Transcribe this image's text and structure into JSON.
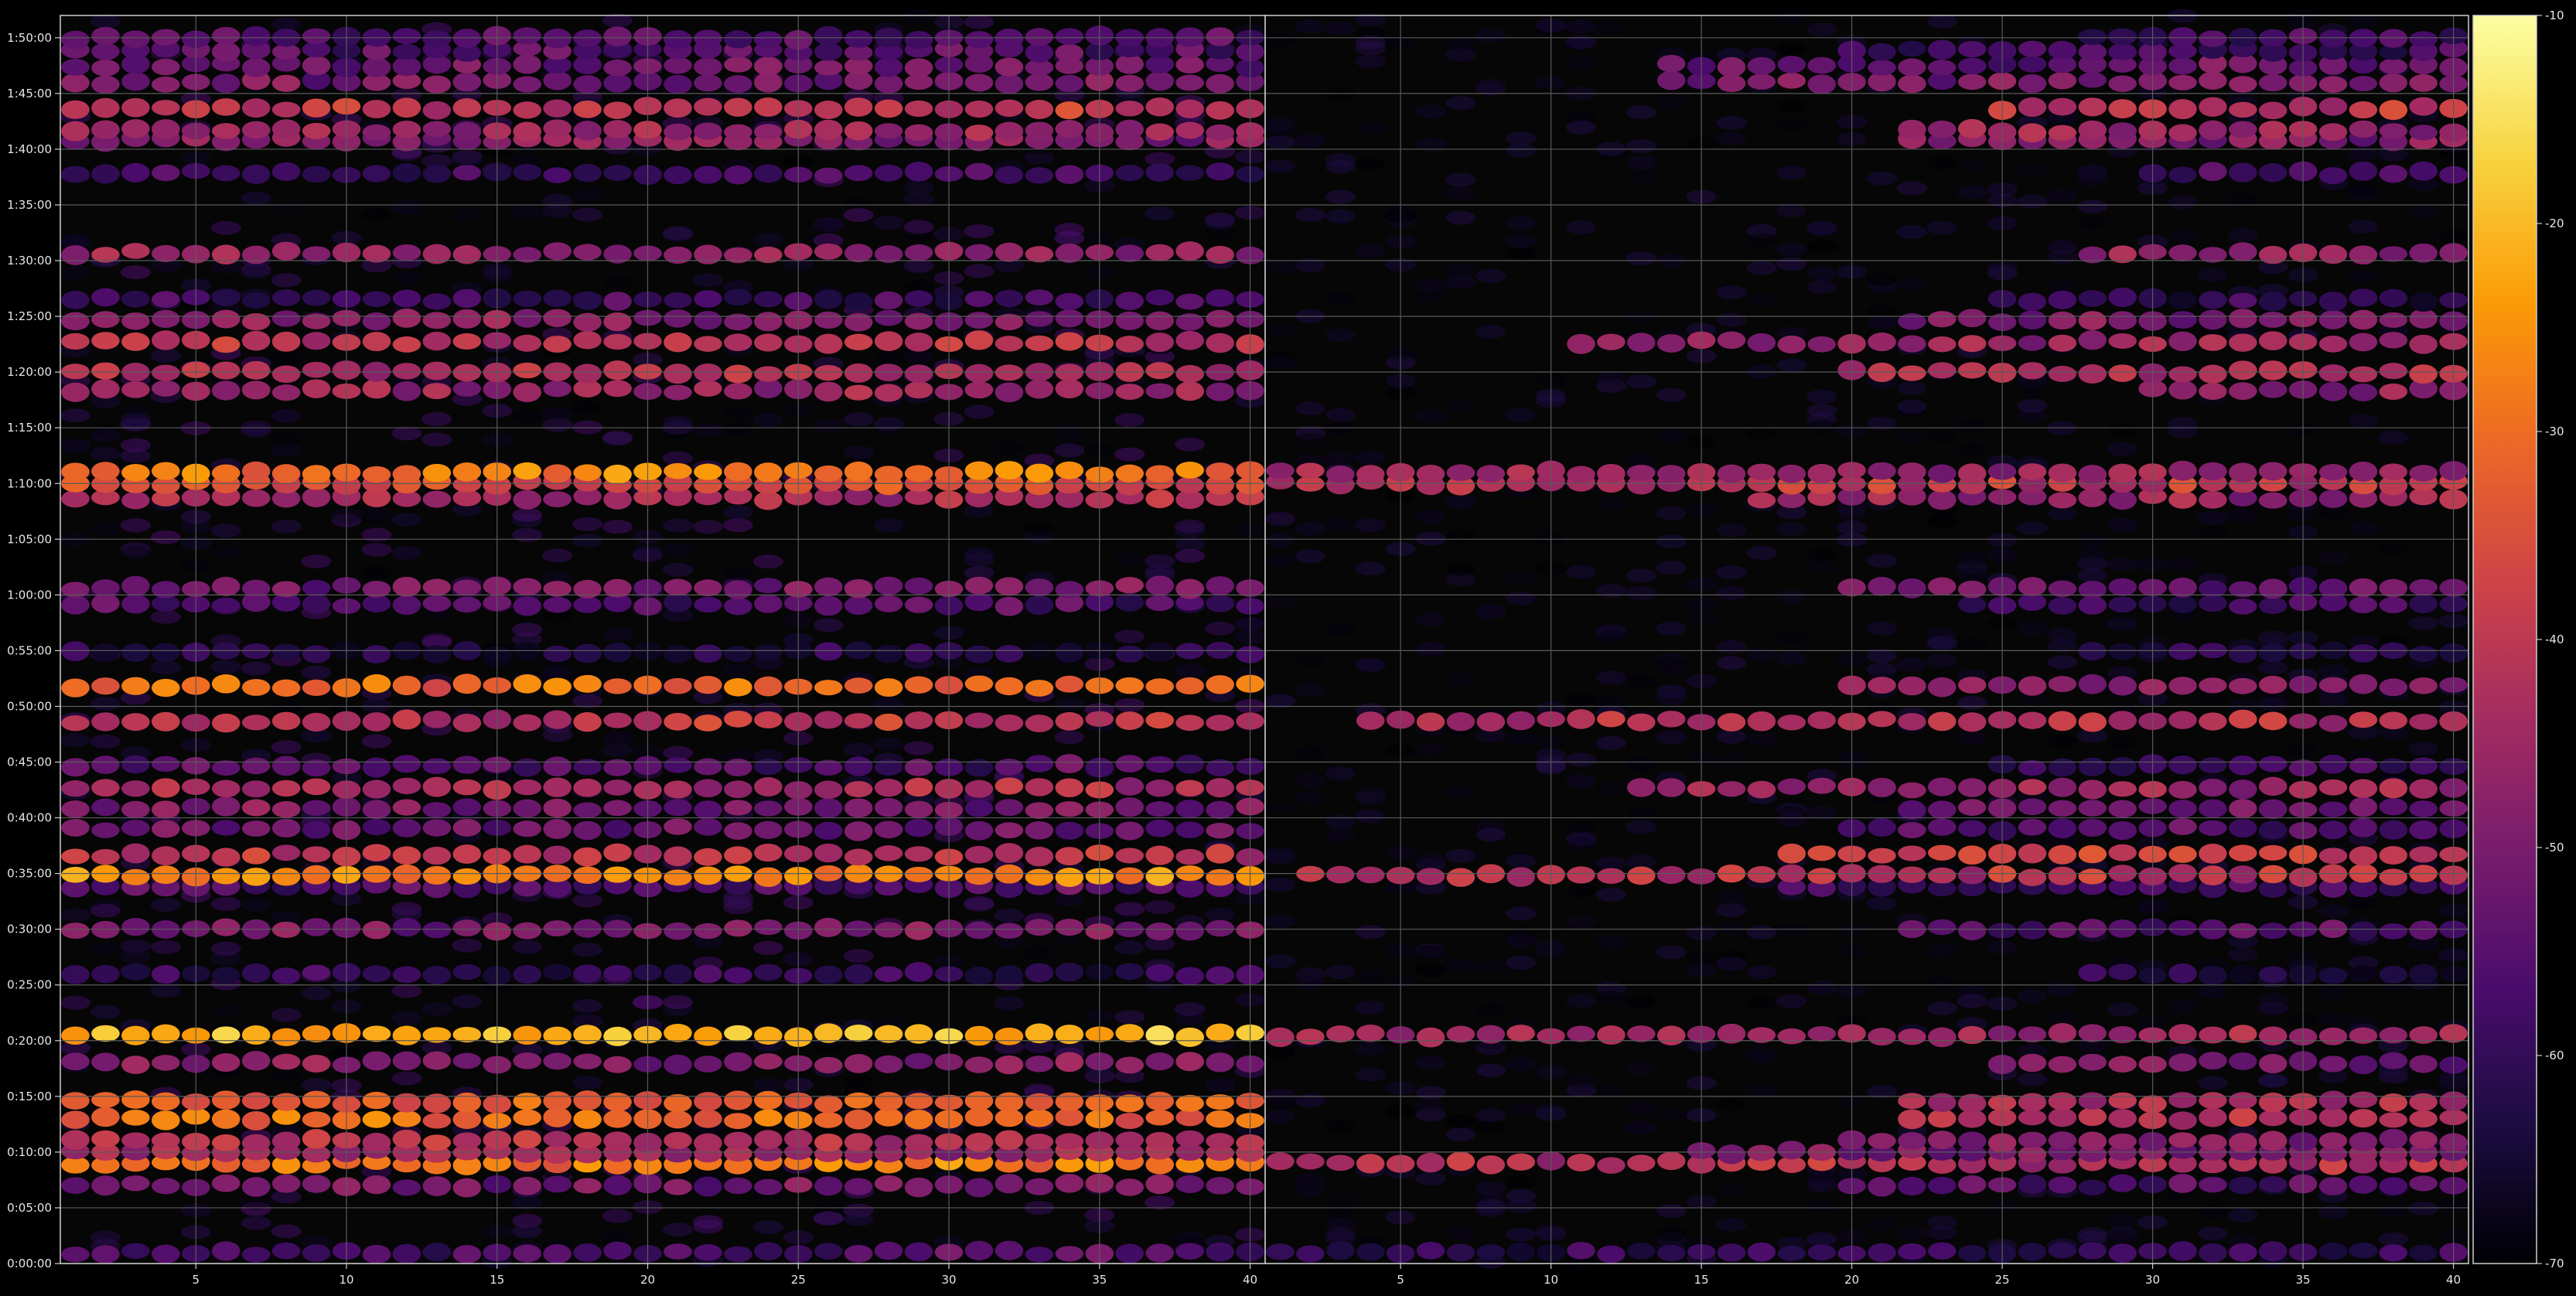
{
  "chart_data": [
    {
      "type": "heatmap",
      "panel": "left",
      "xlim": [
        1,
        40
      ],
      "x_ticks": [
        "5",
        "10",
        "15",
        "20",
        "25",
        "30",
        "35",
        "40"
      ],
      "x_tick_values": [
        5,
        10,
        15,
        20,
        25,
        30,
        35,
        40
      ],
      "y_ticks": [
        "0:00:00",
        "0:05:00",
        "0:10:00",
        "0:15:00",
        "0:20:00",
        "0:25:00",
        "0:30:00",
        "0:35:00",
        "0:40:00",
        "0:45:00",
        "0:50:00",
        "0:55:00",
        "1:00:00",
        "1:05:00",
        "1:10:00",
        "1:15:00",
        "1:20:00",
        "1:25:00",
        "1:30:00",
        "1:35:00",
        "1:40:00",
        "1:45:00",
        "1:50:00"
      ],
      "y_tick_seconds": [
        0,
        300,
        600,
        900,
        1200,
        1500,
        1800,
        2100,
        2400,
        2700,
        3000,
        3300,
        3600,
        3900,
        4200,
        4500,
        4800,
        5100,
        5400,
        5700,
        6000,
        6300,
        6600
      ],
      "y_range_seconds": [
        0,
        6720
      ],
      "grid": true,
      "bands": [
        {
          "t": 60,
          "level": -55,
          "start_col": 1
        },
        {
          "t": 420,
          "level": -50,
          "start_col": 1
        },
        {
          "t": 540,
          "level": -28,
          "start_col": 1
        },
        {
          "t": 600,
          "level": -45,
          "start_col": 1
        },
        {
          "t": 660,
          "level": -42,
          "start_col": 1
        },
        {
          "t": 780,
          "level": -30,
          "start_col": 1
        },
        {
          "t": 870,
          "level": -32,
          "start_col": 1
        },
        {
          "t": 1080,
          "level": -48,
          "start_col": 1
        },
        {
          "t": 1230,
          "level": -20,
          "start_col": 1
        },
        {
          "t": 1560,
          "level": -60,
          "start_col": 1
        },
        {
          "t": 1800,
          "level": -50,
          "start_col": 1
        },
        {
          "t": 2030,
          "level": -55,
          "start_col": 1
        },
        {
          "t": 2090,
          "level": -25,
          "start_col": 1
        },
        {
          "t": 2200,
          "level": -40,
          "start_col": 1
        },
        {
          "t": 2340,
          "level": -52,
          "start_col": 1
        },
        {
          "t": 2450,
          "level": -50,
          "start_col": 1
        },
        {
          "t": 2560,
          "level": -42,
          "start_col": 1
        },
        {
          "t": 2680,
          "level": -55,
          "start_col": 1
        },
        {
          "t": 2920,
          "level": -40,
          "start_col": 1
        },
        {
          "t": 3110,
          "level": -30,
          "start_col": 1
        },
        {
          "t": 3290,
          "level": -62,
          "start_col": 1
        },
        {
          "t": 3550,
          "level": -55,
          "start_col": 1
        },
        {
          "t": 3640,
          "level": -50,
          "start_col": 1
        },
        {
          "t": 4120,
          "level": -42,
          "start_col": 1
        },
        {
          "t": 4200,
          "level": -35,
          "start_col": 1
        },
        {
          "t": 4260,
          "level": -28,
          "start_col": 1
        },
        {
          "t": 4700,
          "level": -45,
          "start_col": 1
        },
        {
          "t": 4800,
          "level": -42,
          "start_col": 1
        },
        {
          "t": 4960,
          "level": -40,
          "start_col": 1
        },
        {
          "t": 5080,
          "level": -48,
          "start_col": 1
        },
        {
          "t": 5190,
          "level": -58,
          "start_col": 1
        },
        {
          "t": 5440,
          "level": -45,
          "start_col": 1
        },
        {
          "t": 5870,
          "level": -58,
          "start_col": 1
        },
        {
          "t": 6050,
          "level": -48,
          "start_col": 1
        },
        {
          "t": 6100,
          "level": -45,
          "start_col": 1
        },
        {
          "t": 6220,
          "level": -40,
          "start_col": 1
        },
        {
          "t": 6360,
          "level": -50,
          "start_col": 1
        },
        {
          "t": 6450,
          "level": -52,
          "start_col": 1
        },
        {
          "t": 6530,
          "level": -55,
          "start_col": 1
        },
        {
          "t": 6600,
          "level": -55,
          "start_col": 1
        }
      ]
    },
    {
      "type": "heatmap",
      "panel": "right",
      "xlim": [
        1,
        40
      ],
      "x_ticks": [
        "5",
        "10",
        "15",
        "20",
        "25",
        "30",
        "35",
        "40"
      ],
      "x_tick_values": [
        5,
        10,
        15,
        20,
        25,
        30,
        35,
        40
      ],
      "y_range_seconds": [
        0,
        6720
      ],
      "grid": true,
      "bands": [
        {
          "t": 60,
          "level": -60,
          "start_col": 1
        },
        {
          "t": 420,
          "level": -55,
          "start_col": 20
        },
        {
          "t": 540,
          "level": -42,
          "start_col": 1
        },
        {
          "t": 600,
          "level": -50,
          "start_col": 15
        },
        {
          "t": 660,
          "level": -48,
          "start_col": 20
        },
        {
          "t": 780,
          "level": -40,
          "start_col": 22
        },
        {
          "t": 870,
          "level": -42,
          "start_col": 22
        },
        {
          "t": 1080,
          "level": -50,
          "start_col": 25
        },
        {
          "t": 1230,
          "level": -45,
          "start_col": 1
        },
        {
          "t": 1560,
          "level": -62,
          "start_col": 28
        },
        {
          "t": 1800,
          "level": -55,
          "start_col": 22
        },
        {
          "t": 2030,
          "level": -58,
          "start_col": 18
        },
        {
          "t": 2090,
          "level": -40,
          "start_col": 2
        },
        {
          "t": 2200,
          "level": -38,
          "start_col": 18
        },
        {
          "t": 2340,
          "level": -55,
          "start_col": 20
        },
        {
          "t": 2450,
          "level": -52,
          "start_col": 22
        },
        {
          "t": 2560,
          "level": -45,
          "start_col": 13
        },
        {
          "t": 2680,
          "level": -58,
          "start_col": 25
        },
        {
          "t": 2920,
          "level": -42,
          "start_col": 4
        },
        {
          "t": 3110,
          "level": -48,
          "start_col": 20
        },
        {
          "t": 3290,
          "level": -63,
          "start_col": 28
        },
        {
          "t": 3550,
          "level": -58,
          "start_col": 24
        },
        {
          "t": 3640,
          "level": -52,
          "start_col": 20
        },
        {
          "t": 4120,
          "level": -45,
          "start_col": 17
        },
        {
          "t": 4200,
          "level": -40,
          "start_col": 1
        },
        {
          "t": 4260,
          "level": -45,
          "start_col": 1
        },
        {
          "t": 4700,
          "level": -48,
          "start_col": 30
        },
        {
          "t": 4800,
          "level": -42,
          "start_col": 20
        },
        {
          "t": 4960,
          "level": -45,
          "start_col": 11
        },
        {
          "t": 5080,
          "level": -50,
          "start_col": 22
        },
        {
          "t": 5190,
          "level": -60,
          "start_col": 25
        },
        {
          "t": 5440,
          "level": -45,
          "start_col": 28
        },
        {
          "t": 5870,
          "level": -58,
          "start_col": 30
        },
        {
          "t": 6050,
          "level": -48,
          "start_col": 22
        },
        {
          "t": 6100,
          "level": -45,
          "start_col": 22
        },
        {
          "t": 6220,
          "level": -40,
          "start_col": 25
        },
        {
          "t": 6360,
          "level": -50,
          "start_col": 14
        },
        {
          "t": 6450,
          "level": -52,
          "start_col": 14
        },
        {
          "t": 6530,
          "level": -58,
          "start_col": 20
        },
        {
          "t": 6600,
          "level": -58,
          "start_col": 28
        }
      ]
    }
  ],
  "colorbar": {
    "ticks": [
      "-10",
      "-20",
      "-30",
      "-40",
      "-50",
      "-60",
      "-70"
    ],
    "tick_values": [
      -10,
      -20,
      -30,
      -40,
      -50,
      -60,
      -70
    ],
    "range": [
      -70,
      -10
    ],
    "colormap": "inferno",
    "colors": [
      "#000004",
      "#1b0c41",
      "#4a0c6b",
      "#781c6d",
      "#a52c60",
      "#cf4446",
      "#ed6925",
      "#fb9b06",
      "#f7d13d",
      "#fcffa4"
    ]
  },
  "style": {
    "background": "#000000",
    "plot_background": "#060606",
    "text_color": "#e6e6e6",
    "grid_color": "#5a5a5a"
  }
}
